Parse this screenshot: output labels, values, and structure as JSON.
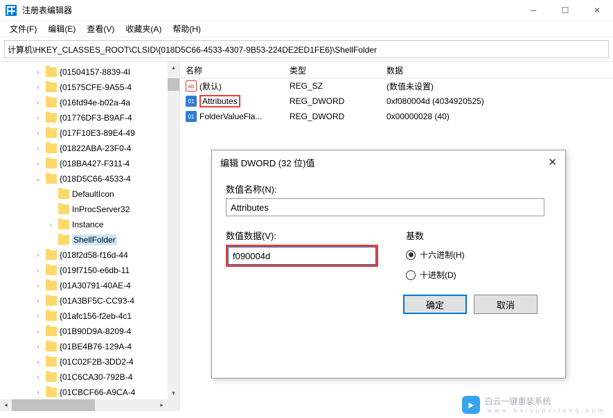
{
  "window": {
    "title": "注册表编辑器"
  },
  "menu": {
    "file": "文件(F)",
    "edit": "编辑(E)",
    "view": "查看(V)",
    "favorites": "收藏夹(A)",
    "help": "帮助(H)"
  },
  "address": "计算机\\HKEY_CLASSES_ROOT\\CLSID\\{018D5C66-4533-4307-9B53-224DE2ED1FE6}\\ShellFolder",
  "columns": {
    "name": "名称",
    "type": "类型",
    "data": "数据"
  },
  "rows": [
    {
      "icon": "ab",
      "name": "(默认)",
      "type": "REG_SZ",
      "data": "(数值未设置)"
    },
    {
      "icon": "bin",
      "name": "Attributes",
      "type": "REG_DWORD",
      "data": "0xf080004d (4034920525)",
      "highlight": true
    },
    {
      "icon": "bin",
      "name": "FolderValueFla...",
      "type": "REG_DWORD",
      "data": "0x00000028 (40)"
    }
  ],
  "tree": {
    "items": [
      "{01504157-8839-4I",
      "{01575CFE-9A55-4",
      "{016fd94e-b02a-4a",
      "{01776DF3-B9AF-4",
      "{017F10E3-89E4-49",
      "{01822ABA-23F0-4",
      "{018BA427-F311-4",
      "{018D5C66-4533-4"
    ],
    "children": [
      {
        "label": "DefaultIcon",
        "chev": false
      },
      {
        "label": "InProcServer32",
        "chev": false
      },
      {
        "label": "Instance",
        "chev": true
      },
      {
        "label": "ShellFolder",
        "chev": false,
        "selected": true
      }
    ],
    "items_after": [
      "{018f2d58-f16d-44",
      "{019f7150-e6db-11",
      "{01A30791-40AE-4",
      "{01A3BF5C-CC93-4",
      "{01afc156-f2eb-4c1",
      "{01B90D9A-8209-4",
      "{01BE4B76-129A-4",
      "{01C02F2B-3DD2-4",
      "{01C6CA30-792B-4",
      "{01CBCF66-A9CA-4"
    ]
  },
  "dialog": {
    "title": "编辑 DWORD (32 位)值",
    "name_label": "数值名称(N):",
    "name_value": "Attributes",
    "data_label": "数值数据(V):",
    "data_value": "f090004d",
    "radix_label": "基数",
    "radix_hex": "十六进制(H)",
    "radix_dec": "十进制(D)",
    "ok": "确定",
    "cancel": "取消"
  },
  "watermark": {
    "text": "白云一键重装系统",
    "sub": "www.baiyunxitong.com"
  }
}
